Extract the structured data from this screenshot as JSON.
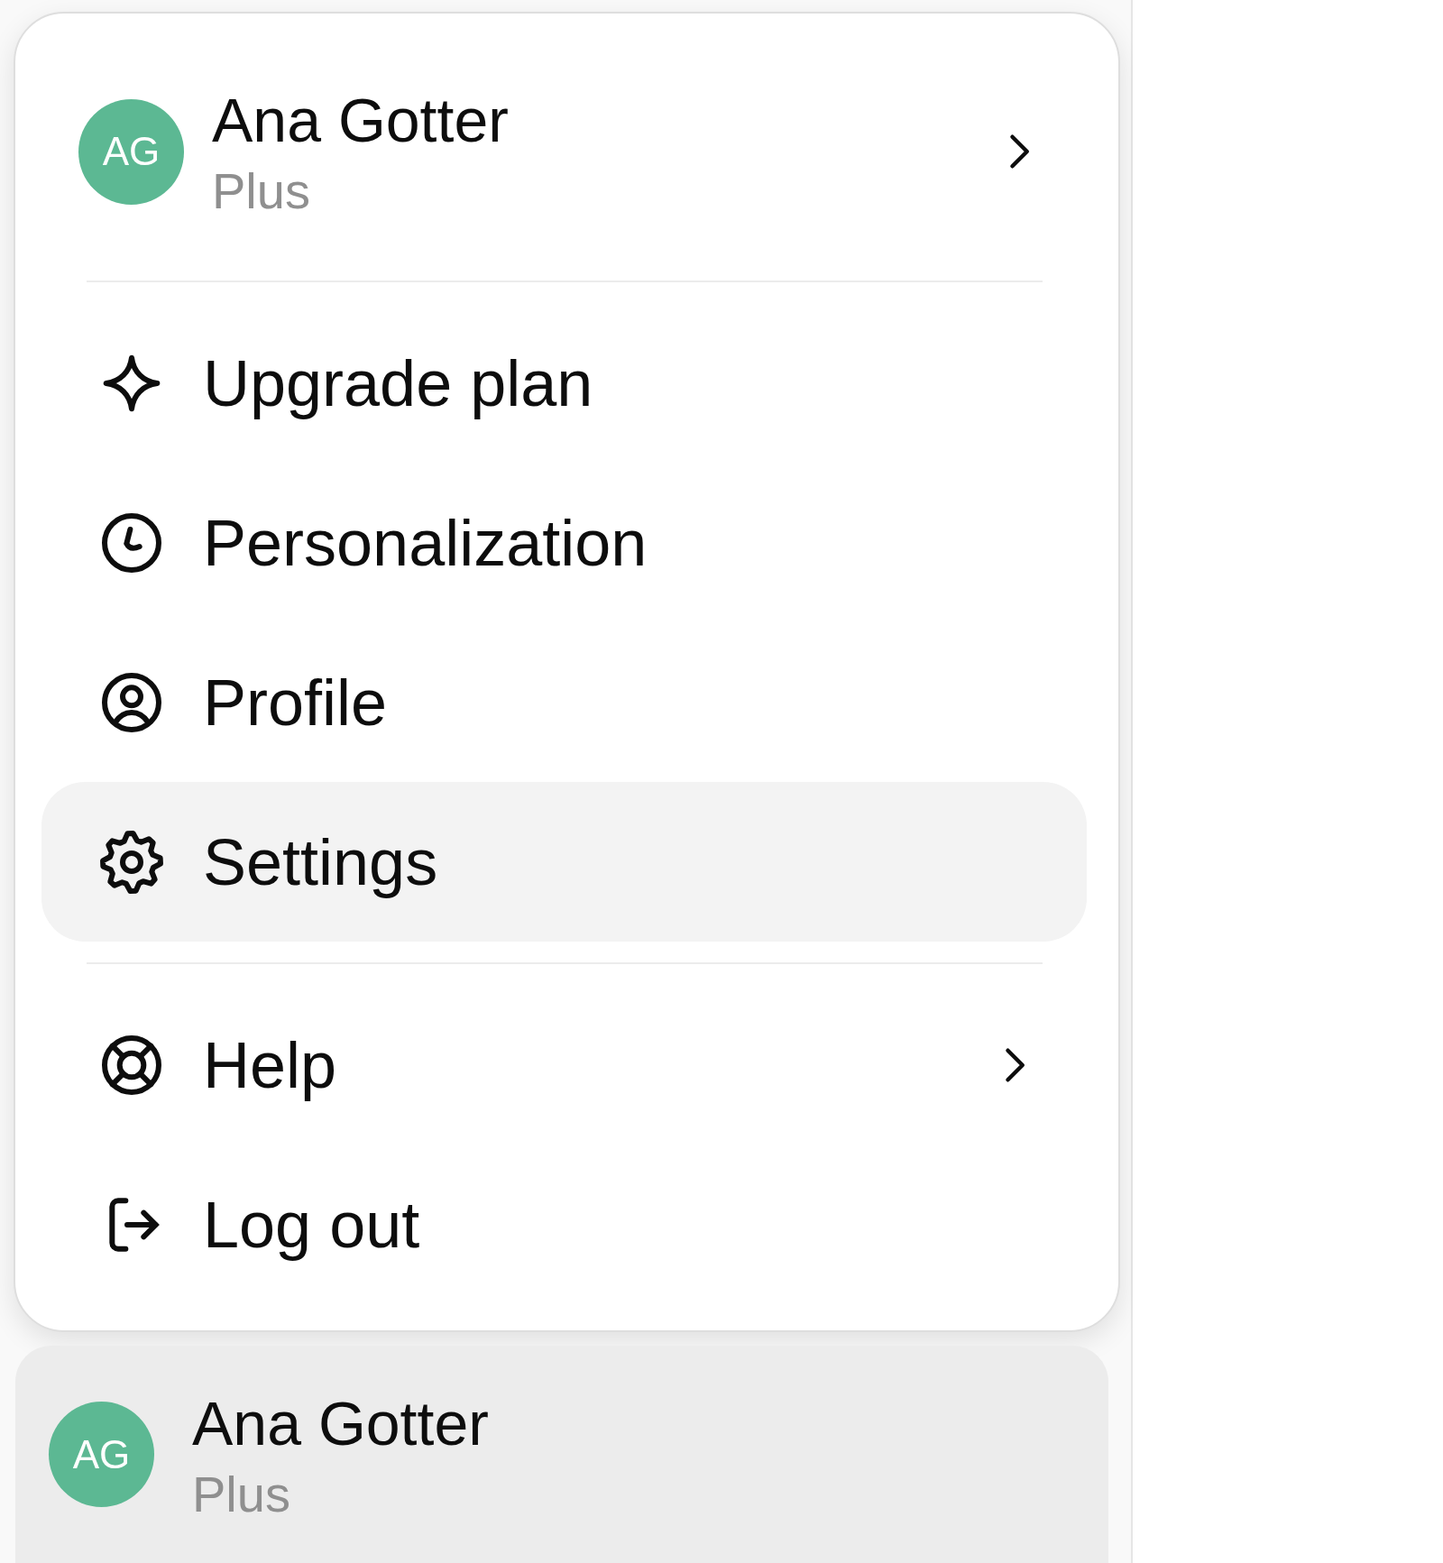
{
  "menu": {
    "user": {
      "initials": "AG",
      "name": "Ana Gotter",
      "plan": "Plus",
      "submenu": true
    },
    "sections": [
      [
        {
          "label": "Upgrade plan",
          "selected": false,
          "submenu": false
        },
        {
          "label": "Personalization",
          "selected": false,
          "submenu": false
        },
        {
          "label": "Profile",
          "selected": false,
          "submenu": false
        },
        {
          "label": "Settings",
          "selected": true,
          "submenu": false
        }
      ],
      [
        {
          "label": "Help",
          "selected": false,
          "submenu": true
        },
        {
          "label": "Log out",
          "selected": false,
          "submenu": false
        }
      ]
    ]
  },
  "account": {
    "initials": "AG",
    "name": "Ana Gotter",
    "plan": "Plus"
  }
}
